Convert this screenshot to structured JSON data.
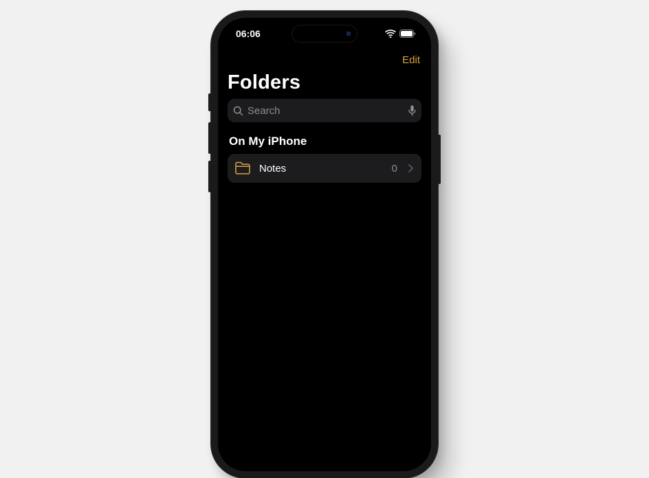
{
  "status": {
    "time": "06:06"
  },
  "nav": {
    "edit_label": "Edit"
  },
  "page": {
    "title": "Folders"
  },
  "search": {
    "placeholder": "Search"
  },
  "sections": [
    {
      "header": "On My iPhone",
      "folders": [
        {
          "name": "Notes",
          "count": "0"
        }
      ]
    }
  ],
  "colors": {
    "accent": "#d9a441",
    "cell_bg": "#1c1c1e",
    "secondary_text": "#8e8e93"
  }
}
